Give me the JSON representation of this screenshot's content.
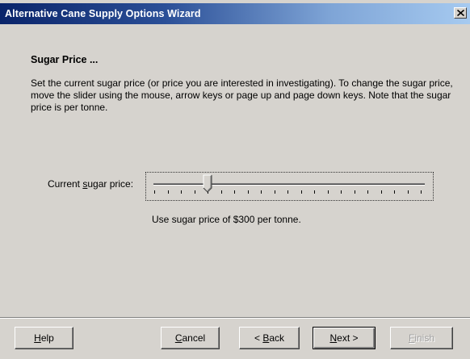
{
  "window": {
    "title": "Alternative Cane Supply Options Wizard",
    "close_label": "x"
  },
  "page": {
    "heading": "Sugar Price ...",
    "description": "Set the current sugar price (or price you are interested in investigating).  To change the sugar price, move the slider using the mouse, arrow keys or page up and page down keys.  Note that the sugar price is per tonne."
  },
  "slider": {
    "label_before": "Current ",
    "label_mnemonic": "s",
    "label_after": "ugar price:",
    "tick_count": 21,
    "selected_tick_index": 4,
    "caption": "Use sugar price of $300 per tonne."
  },
  "buttons": {
    "help": {
      "mnemonic": "H",
      "rest": "elp"
    },
    "cancel": {
      "mnemonic": "C",
      "rest": "ancel"
    },
    "back": {
      "prefix": "< ",
      "mnemonic": "B",
      "rest": "ack"
    },
    "next": {
      "mnemonic": "N",
      "rest": "ext >"
    },
    "finish": {
      "mnemonic": "F",
      "rest": "inish"
    }
  },
  "colors": {
    "title_start": "#0a246a",
    "title_end": "#a6caf0",
    "face": "#d6d3ce"
  }
}
